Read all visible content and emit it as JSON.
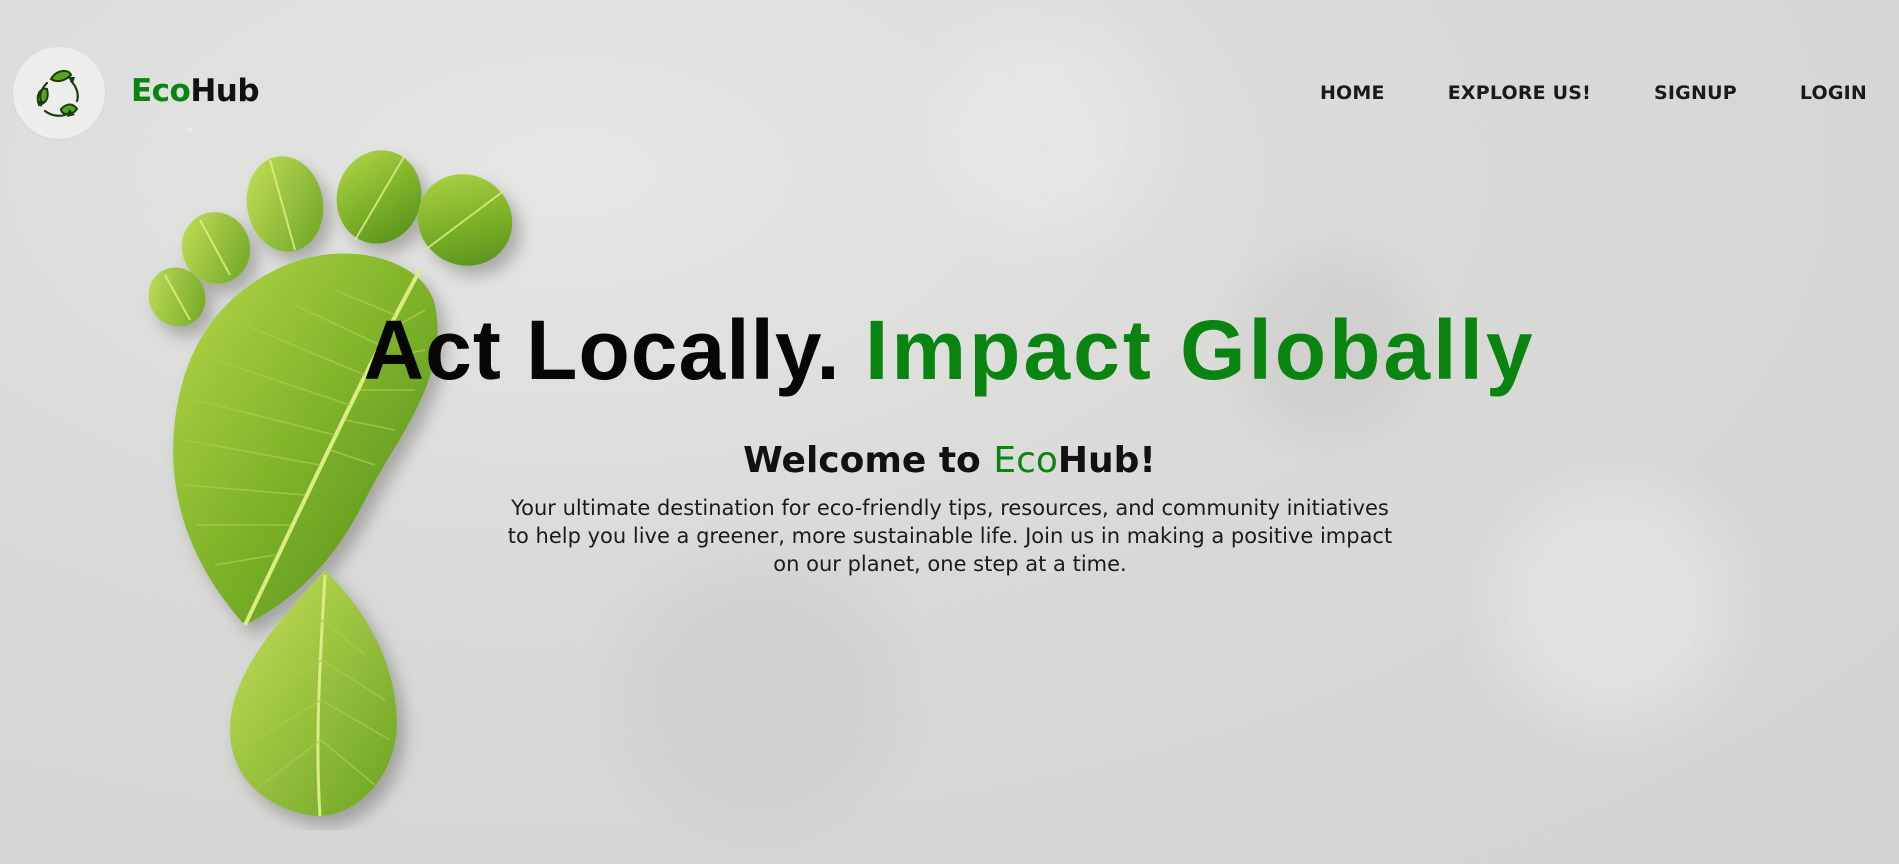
{
  "brand": {
    "prefix": "Eco",
    "suffix": "Hub"
  },
  "nav": {
    "items": [
      {
        "label": "HOME"
      },
      {
        "label": "EXPLORE US!"
      },
      {
        "label": "SIGNUP"
      },
      {
        "label": "LOGIN"
      }
    ]
  },
  "hero": {
    "title_part1": "Act Locally.",
    "title_part2": "Impact Globally",
    "welcome_prefix": "Welcome to ",
    "welcome_eco": "Eco",
    "welcome_suffix": "Hub!",
    "description": "Your ultimate destination for eco-friendly tips, resources, and community initiatives to help you live a greener, more sustainable life. Join us in making a positive impact on our planet, one step at a time."
  },
  "icons": {
    "logo": "recycle-leaves-icon",
    "hero_image": "leaf-footprint-image"
  },
  "colors": {
    "accent_green": "#0a8410",
    "text_dark": "#111111",
    "background": "#d9d9d7"
  }
}
